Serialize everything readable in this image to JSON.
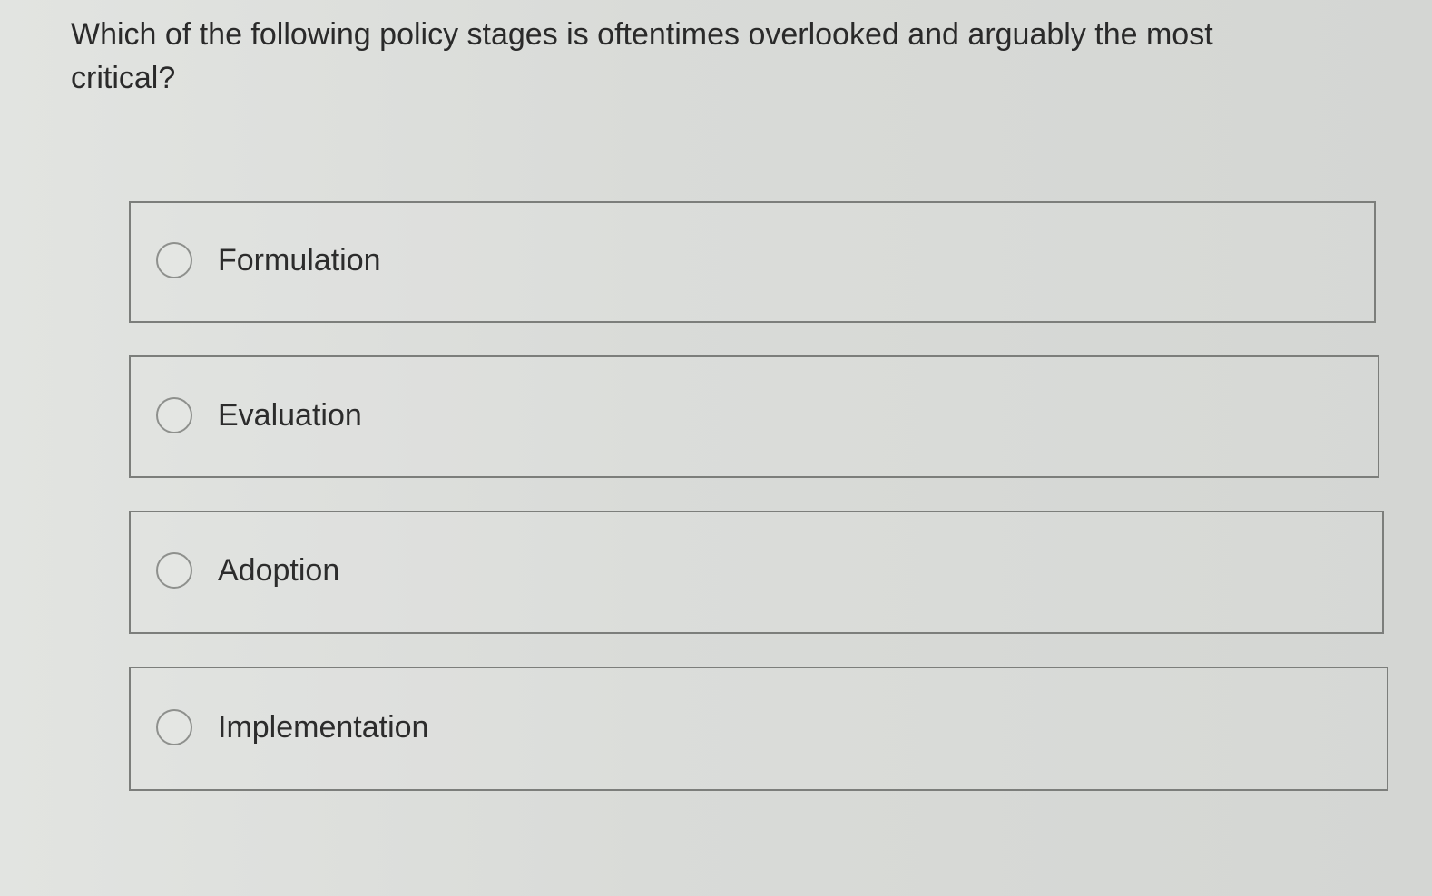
{
  "question": {
    "text": "Which of the following policy stages is oftentimes overlooked and arguably the most critical?"
  },
  "options": [
    {
      "label": "Formulation",
      "selected": false
    },
    {
      "label": "Evaluation",
      "selected": false
    },
    {
      "label": "Adoption",
      "selected": false
    },
    {
      "label": "Implementation",
      "selected": false
    }
  ],
  "icons": {
    "radio": "radio-button-empty-icon"
  },
  "colors": {
    "background": "#dcdedb",
    "border": "#7c7e7b",
    "text": "#2c2c2c"
  }
}
